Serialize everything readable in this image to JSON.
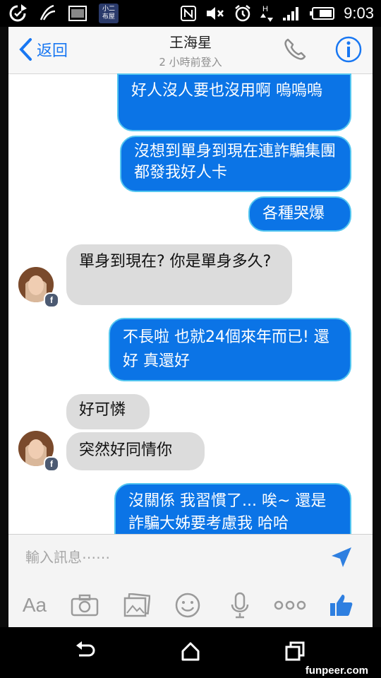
{
  "status_bar": {
    "time": "9:03",
    "app_badge": "小二\n布屋",
    "icons": [
      "sync-icon",
      "swoosh-icon",
      "image-icon",
      "app-icon",
      "nfc-icon",
      "mute-icon",
      "alarm-icon",
      "data-icon",
      "signal-icon",
      "battery-icon"
    ]
  },
  "header": {
    "back_label": "返回",
    "contact_name": "王海星",
    "contact_status": "2 小時前登入",
    "icons": [
      "chevron-left-icon",
      "phone-icon",
      "info-icon"
    ],
    "accent": "#1877f2"
  },
  "messages": [
    {
      "side": "out",
      "text": "好人沒人要也沒用啊 嗚嗚嗚"
    },
    {
      "side": "out",
      "text": "沒想到單身到現在連詐騙集團都發我好人卡"
    },
    {
      "side": "out",
      "text": "各種哭爆"
    },
    {
      "side": "in",
      "text": "單身到現在? 你是單身多久?"
    },
    {
      "side": "out",
      "text": "不長啦 也就24個來年而已! 還好 真還好"
    },
    {
      "side": "in",
      "text": "好可憐"
    },
    {
      "side": "in",
      "text": "突然好同情你"
    },
    {
      "side": "out",
      "text": "沒關係 我習慣了... 唉~ 還是詐騙大姊要考慮我 哈哈"
    }
  ],
  "colors": {
    "outgoing_bubble": "#0b74e6",
    "outgoing_border": "#54c6f0",
    "incoming_bubble": "#dcdcdc"
  },
  "composer": {
    "placeholder": "輸入訊息⋯⋯",
    "toolbar": [
      "Aa",
      "camera-icon",
      "gallery-icon",
      "smiley-icon",
      "microphone-icon",
      "more-icon",
      "thumbs-up-icon"
    ],
    "aa_label": "Aa"
  },
  "nav_bar": {
    "icons": [
      "back-icon",
      "home-icon",
      "recents-icon"
    ]
  },
  "watermark": "funpeer.com"
}
